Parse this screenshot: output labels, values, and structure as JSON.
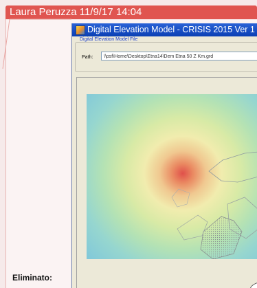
{
  "comment": {
    "author_date": "Laura Peruzza 11/9/17 14:04",
    "deleted_label": "Eliminato:"
  },
  "window": {
    "title": "Digital Elevation Model - CRISIS 2015 Ver 1",
    "icon": "app-icon",
    "file_group": {
      "legend": "Digital Elevation Model File",
      "path_label": "Path:",
      "path_value": "\\\\psf\\Home\\Desktop\\Etna14\\Dem Etna 50 Z Km.grd"
    }
  },
  "colors": {
    "comment_header": "#e05550",
    "titlebar": "#0a3fb4",
    "window_bg": "#ece9d8"
  }
}
